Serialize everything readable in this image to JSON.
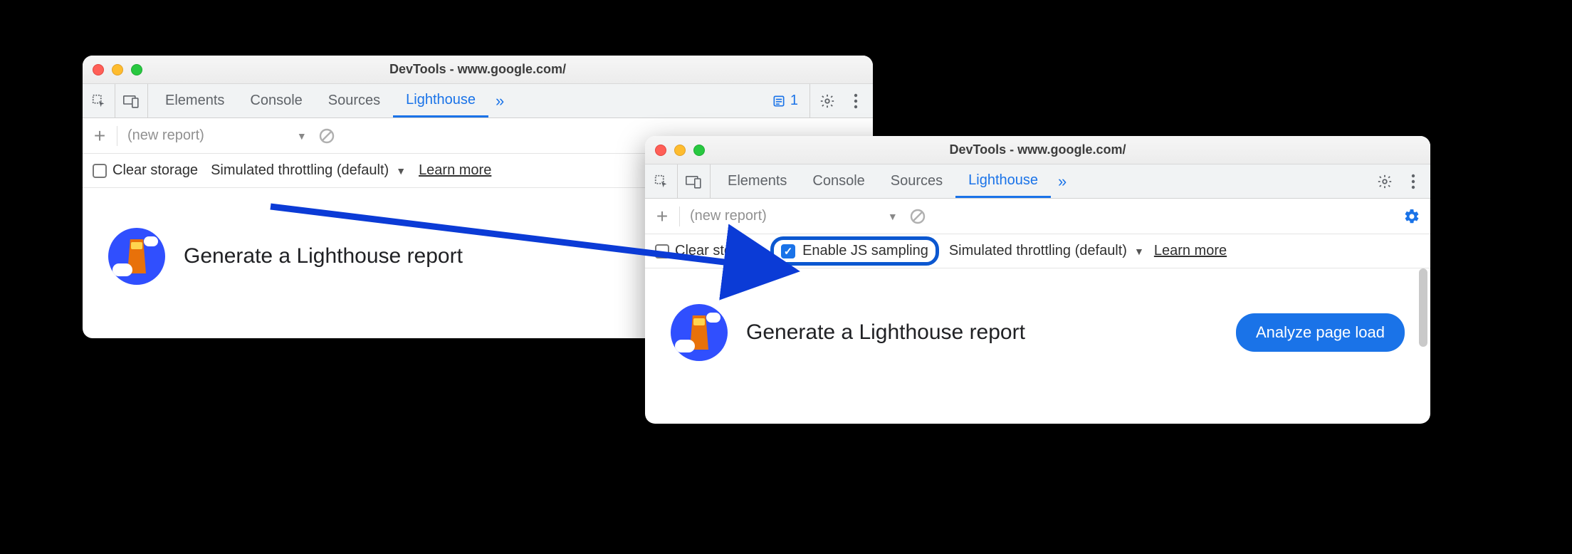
{
  "shared": {
    "window_title": "DevTools - www.google.com/",
    "tabs": {
      "elements": "Elements",
      "console": "Console",
      "sources": "Sources",
      "lighthouse": "Lighthouse"
    },
    "overflow_glyph": "»",
    "issues_count": "1",
    "new_report": "(new report)",
    "clear_storage": "Clear storage",
    "throttling": "Simulated throttling (default)",
    "learn_more": "Learn more",
    "heading": "Generate a Lighthouse report",
    "analyze_label": "Analyze page load"
  },
  "right": {
    "enable_js_sampling": "Enable JS sampling"
  },
  "icons": {
    "inspect": "inspect-icon",
    "device": "device-toggle-icon",
    "gear": "gear-icon",
    "kebab": "kebab-icon",
    "bluegear": "blue-gear-icon",
    "plus": "plus-icon",
    "cancel": "cancel-icon",
    "caret": "caret-down-icon",
    "issues": "issues-icon"
  },
  "colors": {
    "accent": "#1a73e8",
    "highlight": "#0b57d0"
  }
}
